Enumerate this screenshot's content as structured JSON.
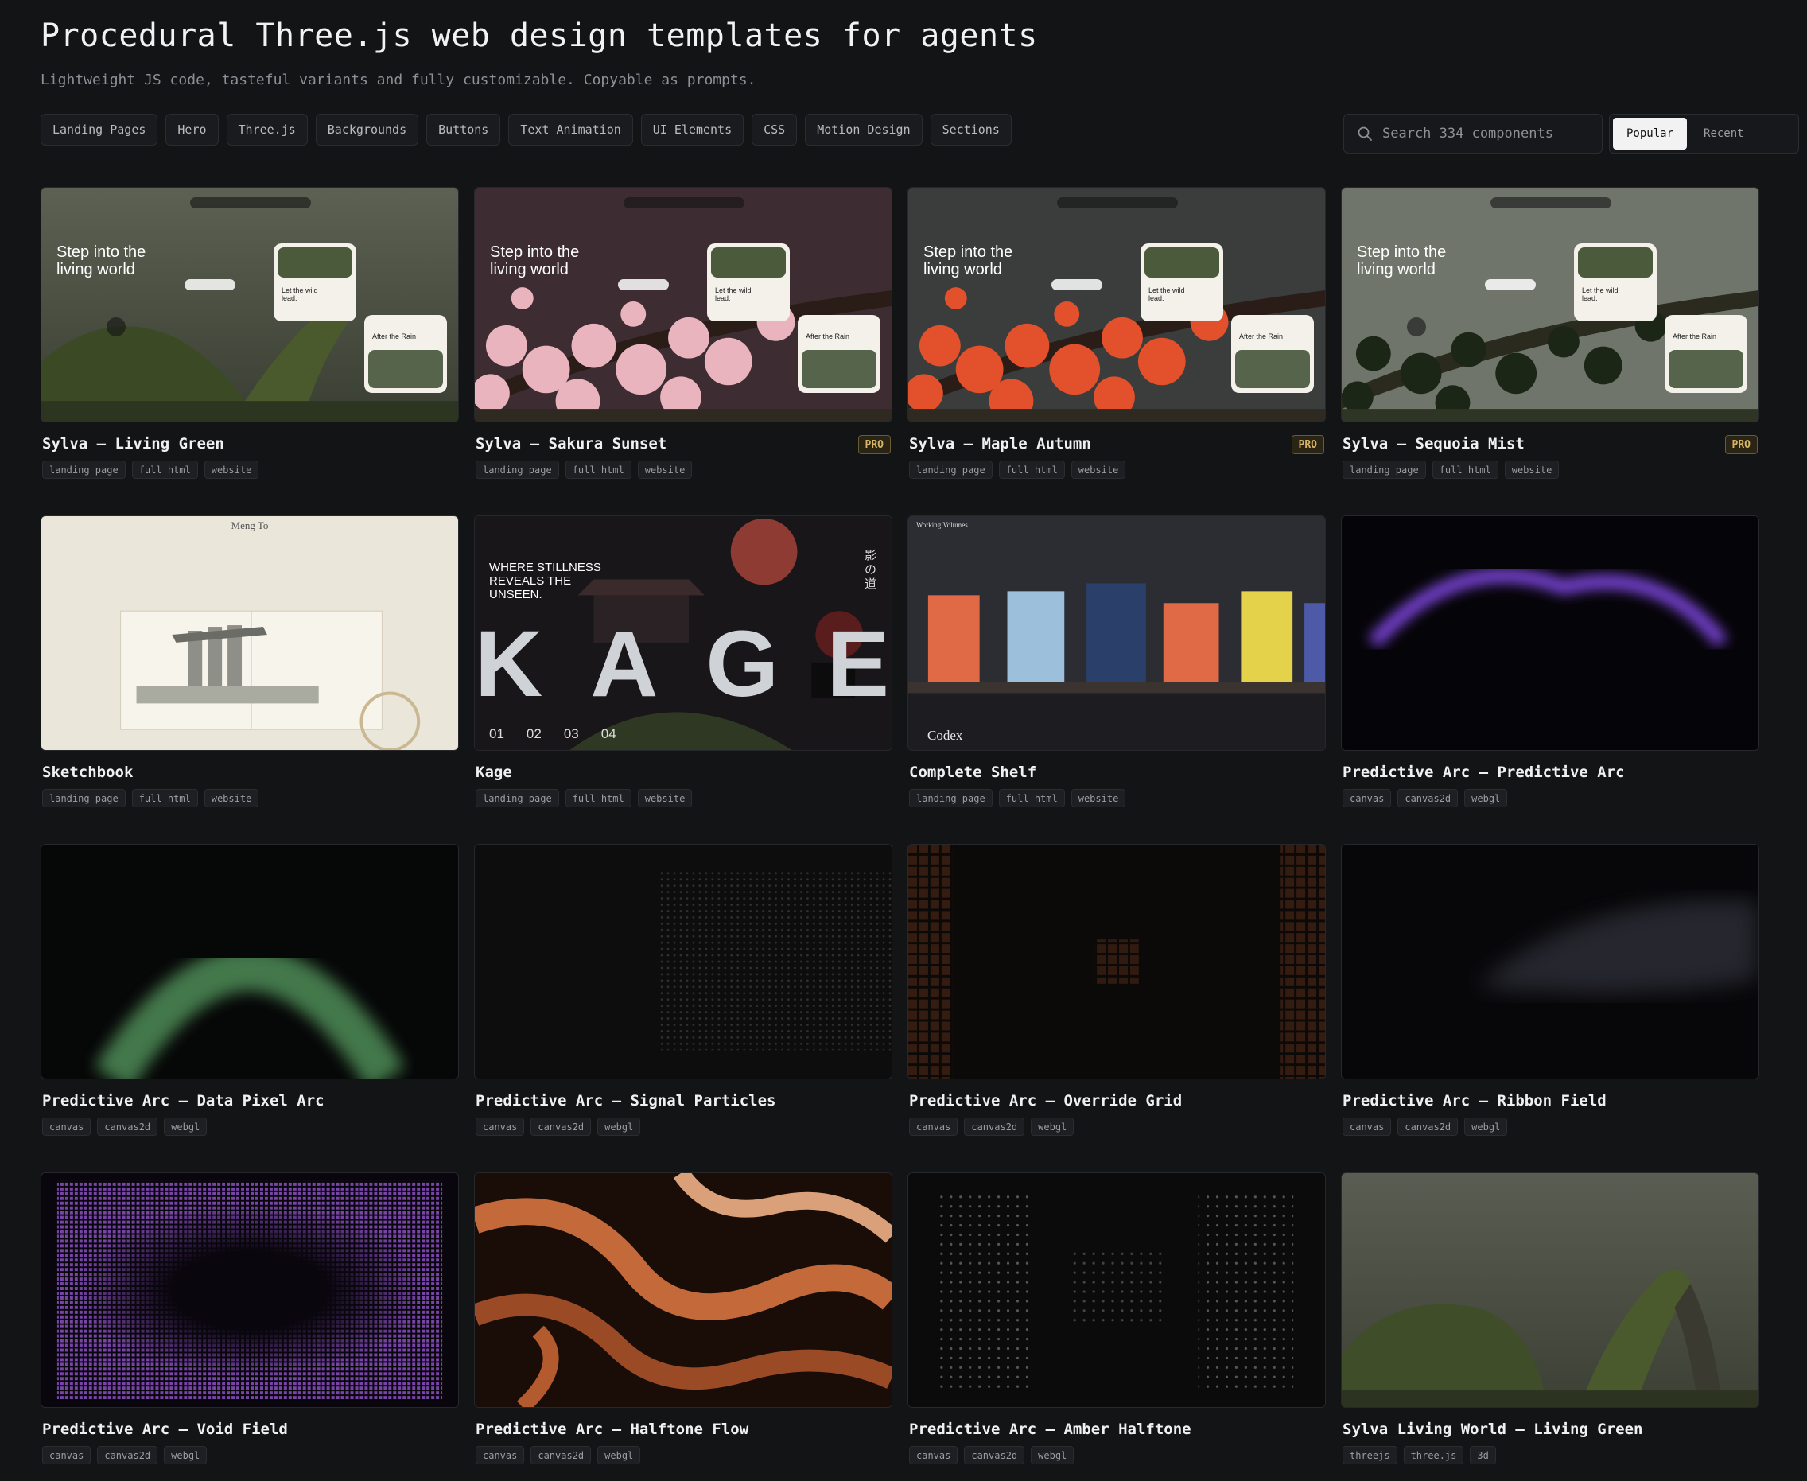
{
  "header": {
    "title": "Procedural Three.js web design templates for agents",
    "subtitle": "Lightweight JS code, tasteful variants and fully customizable. Copyable as prompts."
  },
  "filters": [
    "Landing Pages",
    "Hero",
    "Three.js",
    "Backgrounds",
    "Buttons",
    "Text Animation",
    "UI Elements",
    "CSS",
    "Motion Design",
    "Sections"
  ],
  "search": {
    "placeholder": "Search 334 components",
    "icon": "search-icon"
  },
  "sort": {
    "options": [
      "Popular",
      "Recent"
    ],
    "active": "Popular"
  },
  "cards": [
    {
      "title": "Sylva — Living Green",
      "pro": false,
      "tags": [
        "landing page",
        "full html",
        "website"
      ]
    },
    {
      "title": "Sylva — Sakura Sunset",
      "pro": true,
      "pro_label": "PRO",
      "tags": [
        "landing page",
        "full html",
        "website"
      ]
    },
    {
      "title": "Sylva — Maple Autumn",
      "pro": true,
      "pro_label": "PRO",
      "tags": [
        "landing page",
        "full html",
        "website"
      ]
    },
    {
      "title": "Sylva — Sequoia Mist",
      "pro": true,
      "pro_label": "PRO",
      "tags": [
        "landing page",
        "full html",
        "website"
      ]
    },
    {
      "title": "Sketchbook",
      "pro": false,
      "tags": [
        "landing page",
        "full html",
        "website"
      ]
    },
    {
      "title": "Kage",
      "pro": false,
      "tags": [
        "landing page",
        "full html",
        "website"
      ]
    },
    {
      "title": "Complete Shelf",
      "pro": false,
      "tags": [
        "landing page",
        "full html",
        "website"
      ]
    },
    {
      "title": "Predictive Arc — Predictive Arc",
      "pro": false,
      "tags": [
        "canvas",
        "canvas2d",
        "webgl"
      ]
    },
    {
      "title": "Predictive Arc — Data Pixel Arc",
      "pro": false,
      "tags": [
        "canvas",
        "canvas2d",
        "webgl"
      ]
    },
    {
      "title": "Predictive Arc — Signal Particles",
      "pro": false,
      "tags": [
        "canvas",
        "canvas2d",
        "webgl"
      ]
    },
    {
      "title": "Predictive Arc — Override Grid",
      "pro": false,
      "tags": [
        "canvas",
        "canvas2d",
        "webgl"
      ]
    },
    {
      "title": "Predictive Arc — Ribbon Field",
      "pro": false,
      "tags": [
        "canvas",
        "canvas2d",
        "webgl"
      ]
    },
    {
      "title": "Predictive Arc — Void Field",
      "pro": false,
      "tags": [
        "canvas",
        "canvas2d",
        "webgl"
      ]
    },
    {
      "title": "Predictive Arc — Halftone Flow",
      "pro": false,
      "tags": [
        "canvas",
        "canvas2d",
        "webgl"
      ]
    },
    {
      "title": "Predictive Arc — Amber Halftone",
      "pro": false,
      "tags": [
        "canvas",
        "canvas2d",
        "webgl"
      ]
    },
    {
      "title": "Sylva Living World — Living Green",
      "pro": false,
      "tags": [
        "threejs",
        "three.js",
        "3d"
      ]
    }
  ],
  "thumbs": {
    "sylva_heading": "Step into the living world",
    "sylva_card1": "Let the wild lead.",
    "sylva_card2": "After the Rain",
    "sketchbook_name": "Meng To",
    "kage_heading": "WHERE STILLNESS REVEALS THE UNSEEN.",
    "kage_letters": "KAGE",
    "kage_kanji": "影の道",
    "kage_nums": [
      "01",
      "02",
      "03",
      "04"
    ],
    "shelf_name": "Codex",
    "shelf_corner": "Working Volumes"
  },
  "colors": {
    "background": "#131416",
    "pro_accent": "#d8b565"
  }
}
